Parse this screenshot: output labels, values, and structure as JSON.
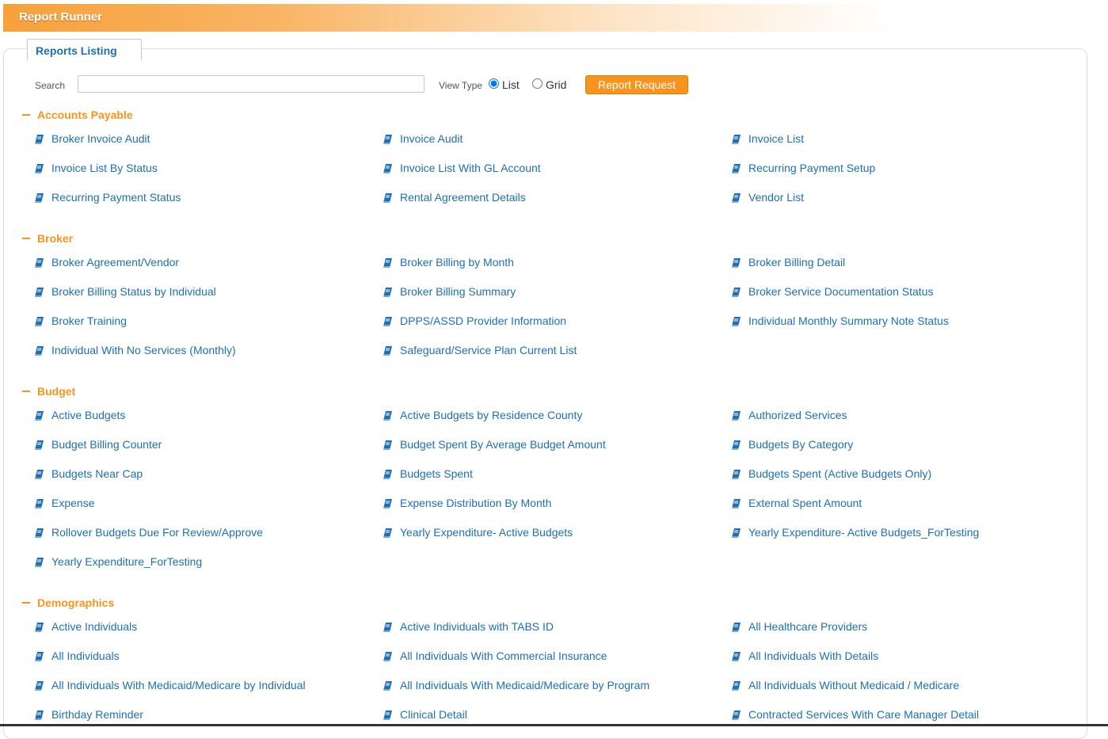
{
  "app": {
    "title": "Report Runner"
  },
  "tab": {
    "label": "Reports Listing"
  },
  "toolbar": {
    "search_label": "Search",
    "search_value": "",
    "search_placeholder": "",
    "view_type_label": "View Type",
    "view_options": [
      "List",
      "Grid"
    ],
    "view_selected": "List",
    "request_button": "Report Request"
  },
  "colors": {
    "accent": "#f7941d",
    "link": "#1e6fb4"
  },
  "sections": [
    {
      "title": "Accounts Payable",
      "items": [
        "Broker Invoice Audit",
        "Invoice Audit",
        "Invoice List",
        "Invoice List By Status",
        "Invoice List With GL Account",
        "Recurring Payment Setup",
        "Recurring Payment Status",
        "Rental Agreement Details",
        "Vendor List"
      ]
    },
    {
      "title": "Broker",
      "items": [
        "Broker Agreement/Vendor",
        "Broker Billing by Month",
        "Broker Billing Detail",
        "Broker Billing Status by Individual",
        "Broker Billing Summary",
        "Broker Service Documentation Status",
        "Broker Training",
        "DPPS/ASSD Provider Information",
        "Individual Monthly Summary Note Status",
        "Individual With No Services (Monthly)",
        "Safeguard/Service Plan Current List"
      ]
    },
    {
      "title": "Budget",
      "items": [
        "Active Budgets",
        "Active Budgets by Residence County",
        "Authorized Services",
        "Budget Billing Counter",
        "Budget Spent By Average Budget Amount",
        "Budgets By Category",
        "Budgets Near Cap",
        "Budgets Spent",
        "Budgets Spent (Active Budgets Only)",
        "Expense",
        "Expense Distribution By Month",
        "External Spent Amount",
        "Rollover Budgets Due For Review/Approve",
        "Yearly Expenditure- Active Budgets",
        "Yearly Expenditure- Active Budgets_ForTesting",
        "Yearly Expenditure_ForTesting"
      ]
    },
    {
      "title": "Demographics",
      "items": [
        "Active Individuals",
        "Active Individuals with TABS ID",
        "All Healthcare Providers",
        "All Individuals",
        "All Individuals With Commercial Insurance",
        "All Individuals With Details",
        "All Individuals With Medicaid/Medicare by Individual",
        "All Individuals With Medicaid/Medicare by Program",
        "All Individuals Without Medicaid / Medicare",
        "Birthday Reminder",
        "Clinical Detail",
        "Contracted Services With Care Manager Detail"
      ]
    }
  ]
}
